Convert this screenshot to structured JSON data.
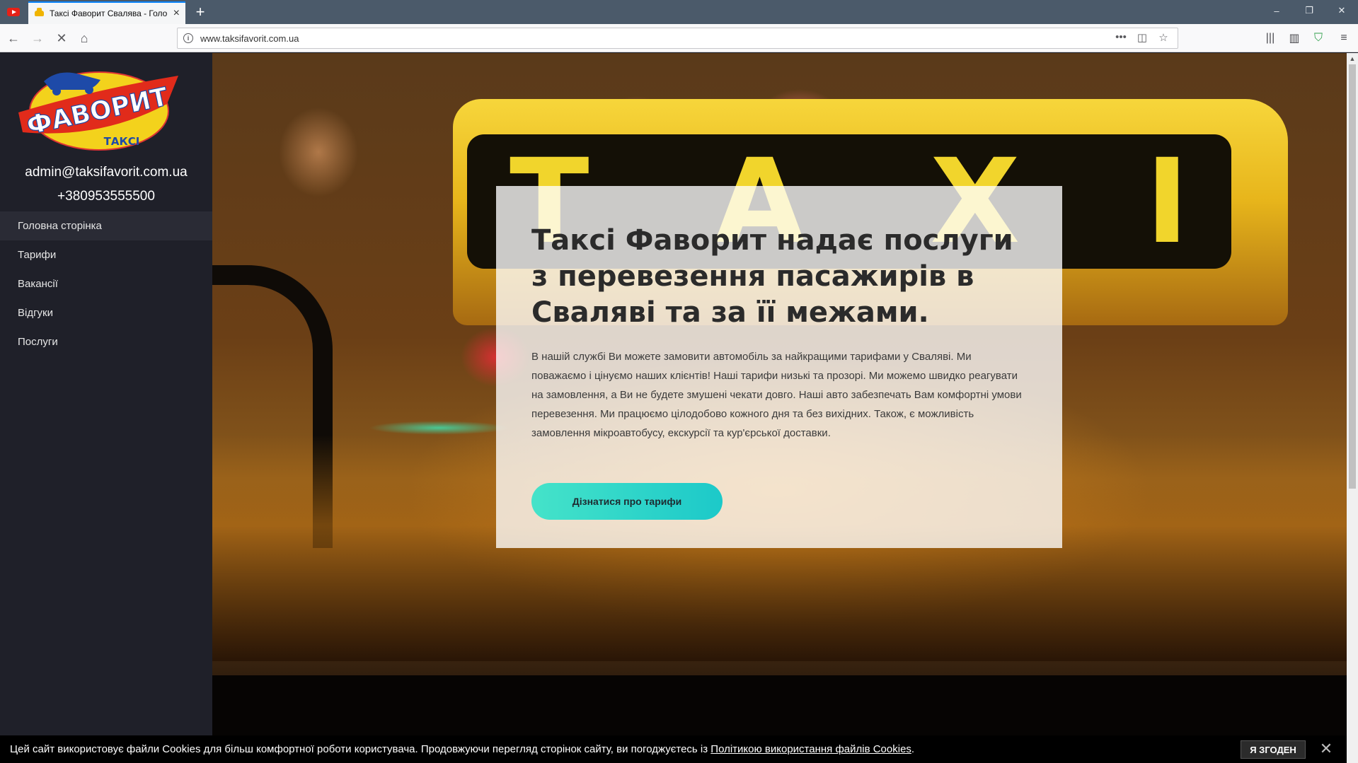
{
  "browser": {
    "tab_title": "Таксі Фаворит Свалява - Голо",
    "url": "www.taksifavorit.com.ua",
    "window_buttons": [
      "–",
      "❐",
      "✕"
    ]
  },
  "sidebar": {
    "logo": {
      "main": "ФАВОРИТ",
      "sub": "ТАКСІ"
    },
    "email": "admin@taksifavorit.com.ua",
    "phone": "+380953555500",
    "menu": [
      {
        "label": "Головна сторінка",
        "active": true
      },
      {
        "label": "Тарифи",
        "active": false
      },
      {
        "label": "Вакансії",
        "active": false
      },
      {
        "label": "Відгуки",
        "active": false
      },
      {
        "label": "Послуги",
        "active": false
      }
    ]
  },
  "hero": {
    "sign_text": "TAXI",
    "title": "Таксі Фаворит надає послуги з перевезення пасажирів в Сваляві та за її межами.",
    "text": "В нашій службі Ви можете замовити автомобіль за найкращими тарифами у Сваляві. Ми поважаємо і цінуємо наших клієнтів! Наші тарифи низькі та прозорі. Ми можемо швидко реагувати на замовлення, а Ви не будете змушені чекати довго. Наші авто забезпечать Вам комфортні умови перевезення. Ми працюємо цілодобово кожного дня та без вихідних. Також, є можливість замовлення мікроавтобусу, екскурсії та кур'єрської доставки.",
    "cta_label": "Дізнатися про тарифи"
  },
  "cookie": {
    "text_before": "Цей сайт використовує файли Cookies для більш комфортної роботи користувача. Продовжуючи перегляд сторінок сайту, ви погоджуєтесь із ",
    "link": "Політикою використання файлів Cookies",
    "text_after": ".",
    "agree_label": "Я ЗГОДЕН",
    "close_label": "✕"
  },
  "colors": {
    "sidebar_bg": "#1f2029",
    "cta_gradient_start": "#45e3c9",
    "cta_gradient_end": "#1cc9c9",
    "accent_yellow": "#f1d52c",
    "arrow_red": "#c0161a"
  }
}
